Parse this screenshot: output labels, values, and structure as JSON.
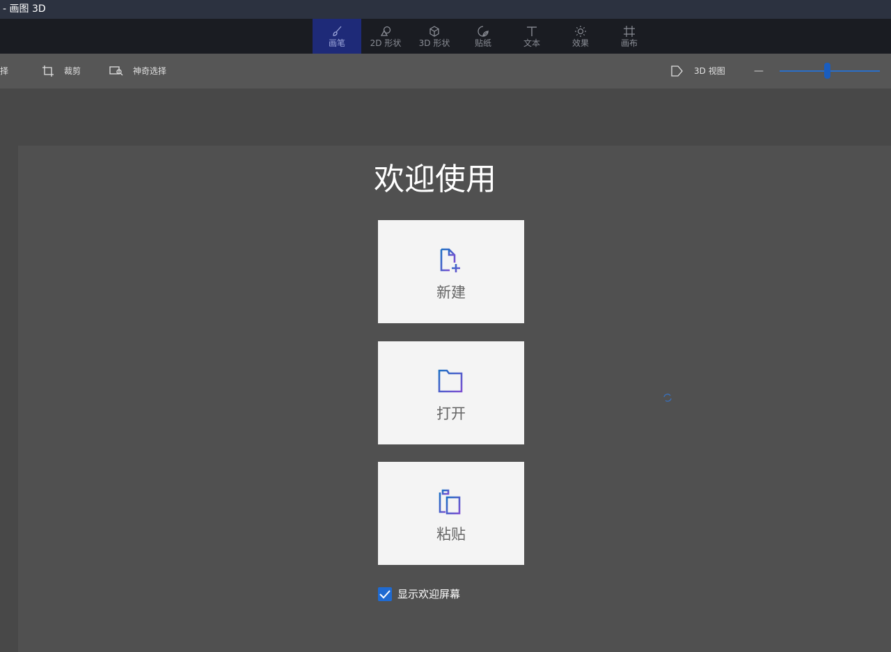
{
  "window": {
    "title": "- 画图 3D"
  },
  "tabs": [
    {
      "label": "画笔",
      "icon": "brush-icon",
      "active": true
    },
    {
      "label": "2D 形状",
      "icon": "shapes-2d-icon",
      "active": false
    },
    {
      "label": "3D 形状",
      "icon": "cube-icon",
      "active": false
    },
    {
      "label": "贴纸",
      "icon": "sticker-icon",
      "active": false
    },
    {
      "label": "文本",
      "icon": "text-icon",
      "active": false
    },
    {
      "label": "效果",
      "icon": "sun-icon",
      "active": false
    },
    {
      "label": "画布",
      "icon": "canvas-icon",
      "active": false
    }
  ],
  "toolbar": {
    "select_label": "选择",
    "crop_label": "裁剪",
    "magic_select_label": "神奇选择",
    "view3d_label": "3D 视图",
    "zoom_minus": "—",
    "zoom_level": 0.47
  },
  "welcome": {
    "title": "欢迎使用",
    "new_label": "新建",
    "open_label": "打开",
    "paste_label": "粘贴",
    "show_welcome_label": "显示欢迎屏幕",
    "show_welcome_checked": true
  },
  "colors": {
    "accent": "#1f6ad1",
    "icon_gradient_start": "#1e6fc4",
    "icon_gradient_end": "#7b4fd1",
    "active_tab": "#1e2a78"
  }
}
